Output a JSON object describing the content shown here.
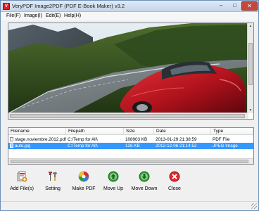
{
  "window": {
    "title": "VeryPDF Image2PDF (PDF E-Book Maker) v3.2",
    "controls": {
      "minimize": "–",
      "maximize": "□",
      "close": "✕"
    }
  },
  "menu": [
    "File(F)",
    "Image(I)",
    "Edit(E)",
    "Help(H)"
  ],
  "preview": {
    "image": "red sports car driving on a mountain road with forested hills",
    "scroll_up": "▲",
    "scroll_down": "▼"
  },
  "file_list": {
    "columns": [
      "Filename",
      "Filepath",
      "Size",
      "Date",
      "Type"
    ],
    "rows": [
      {
        "filename": "stage.noviembre.2012.pdf",
        "filepath": "C:\\Temp for All\\",
        "size": "108903 KB",
        "date": "2013-01-29 21:38:59",
        "type": "PDF File",
        "selected": false
      },
      {
        "filename": "auto.jpg",
        "filepath": "C:\\Temp for All\\",
        "size": "126 KB",
        "date": "2012-12-06 21:14:52",
        "type": "JPEG Image",
        "selected": true
      }
    ]
  },
  "toolbar": [
    {
      "label": "Add File(s)",
      "icon": "add-files-icon"
    },
    {
      "label": "Setting",
      "icon": "setting-tools-icon"
    },
    {
      "label": "Make PDF",
      "icon": "make-pdf-icon"
    },
    {
      "label": "Move Up",
      "icon": "move-up-icon"
    },
    {
      "label": "Move Down",
      "icon": "move-down-icon"
    },
    {
      "label": "Close",
      "icon": "close-x-icon"
    }
  ],
  "colors": {
    "selection": "#3399ff",
    "close_icon": "#e0282c",
    "move_icon": "#2f9a3a",
    "title_close": "#c7463a"
  }
}
